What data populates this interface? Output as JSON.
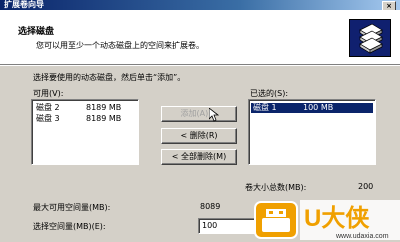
{
  "window": {
    "title": "扩展卷向导",
    "close_glyph": "×"
  },
  "header": {
    "title": "选择磁盘",
    "description": "您可以用至少一个动态磁盘上的空间来扩展卷。",
    "icon": "disk-stack-icon"
  },
  "instruction": "选择要使用的动态磁盘，然后单击“添加”。",
  "available": {
    "label": "可用(V):",
    "rows": [
      {
        "name": "磁盘 2",
        "size": "8189 MB"
      },
      {
        "name": "磁盘 3",
        "size": "8189 MB"
      }
    ]
  },
  "selected": {
    "label": "已选的(S):",
    "rows": [
      {
        "name": "磁盘 1",
        "size": "100 MB"
      }
    ]
  },
  "buttons": {
    "add": "添加(A) >",
    "remove": "< 删除(R)",
    "remove_all": "< 全部删除(M)"
  },
  "fields": {
    "total_label": "卷大小总数(MB):",
    "total_value": "200",
    "max_label": "最大可用空间量(MB):",
    "max_value": "8089",
    "select_label": "选择空间量(MB)(E):",
    "select_value": "100"
  },
  "watermark": {
    "brand": "U大侠",
    "site": "www.udaxia.com",
    "color": "#f0a000"
  }
}
